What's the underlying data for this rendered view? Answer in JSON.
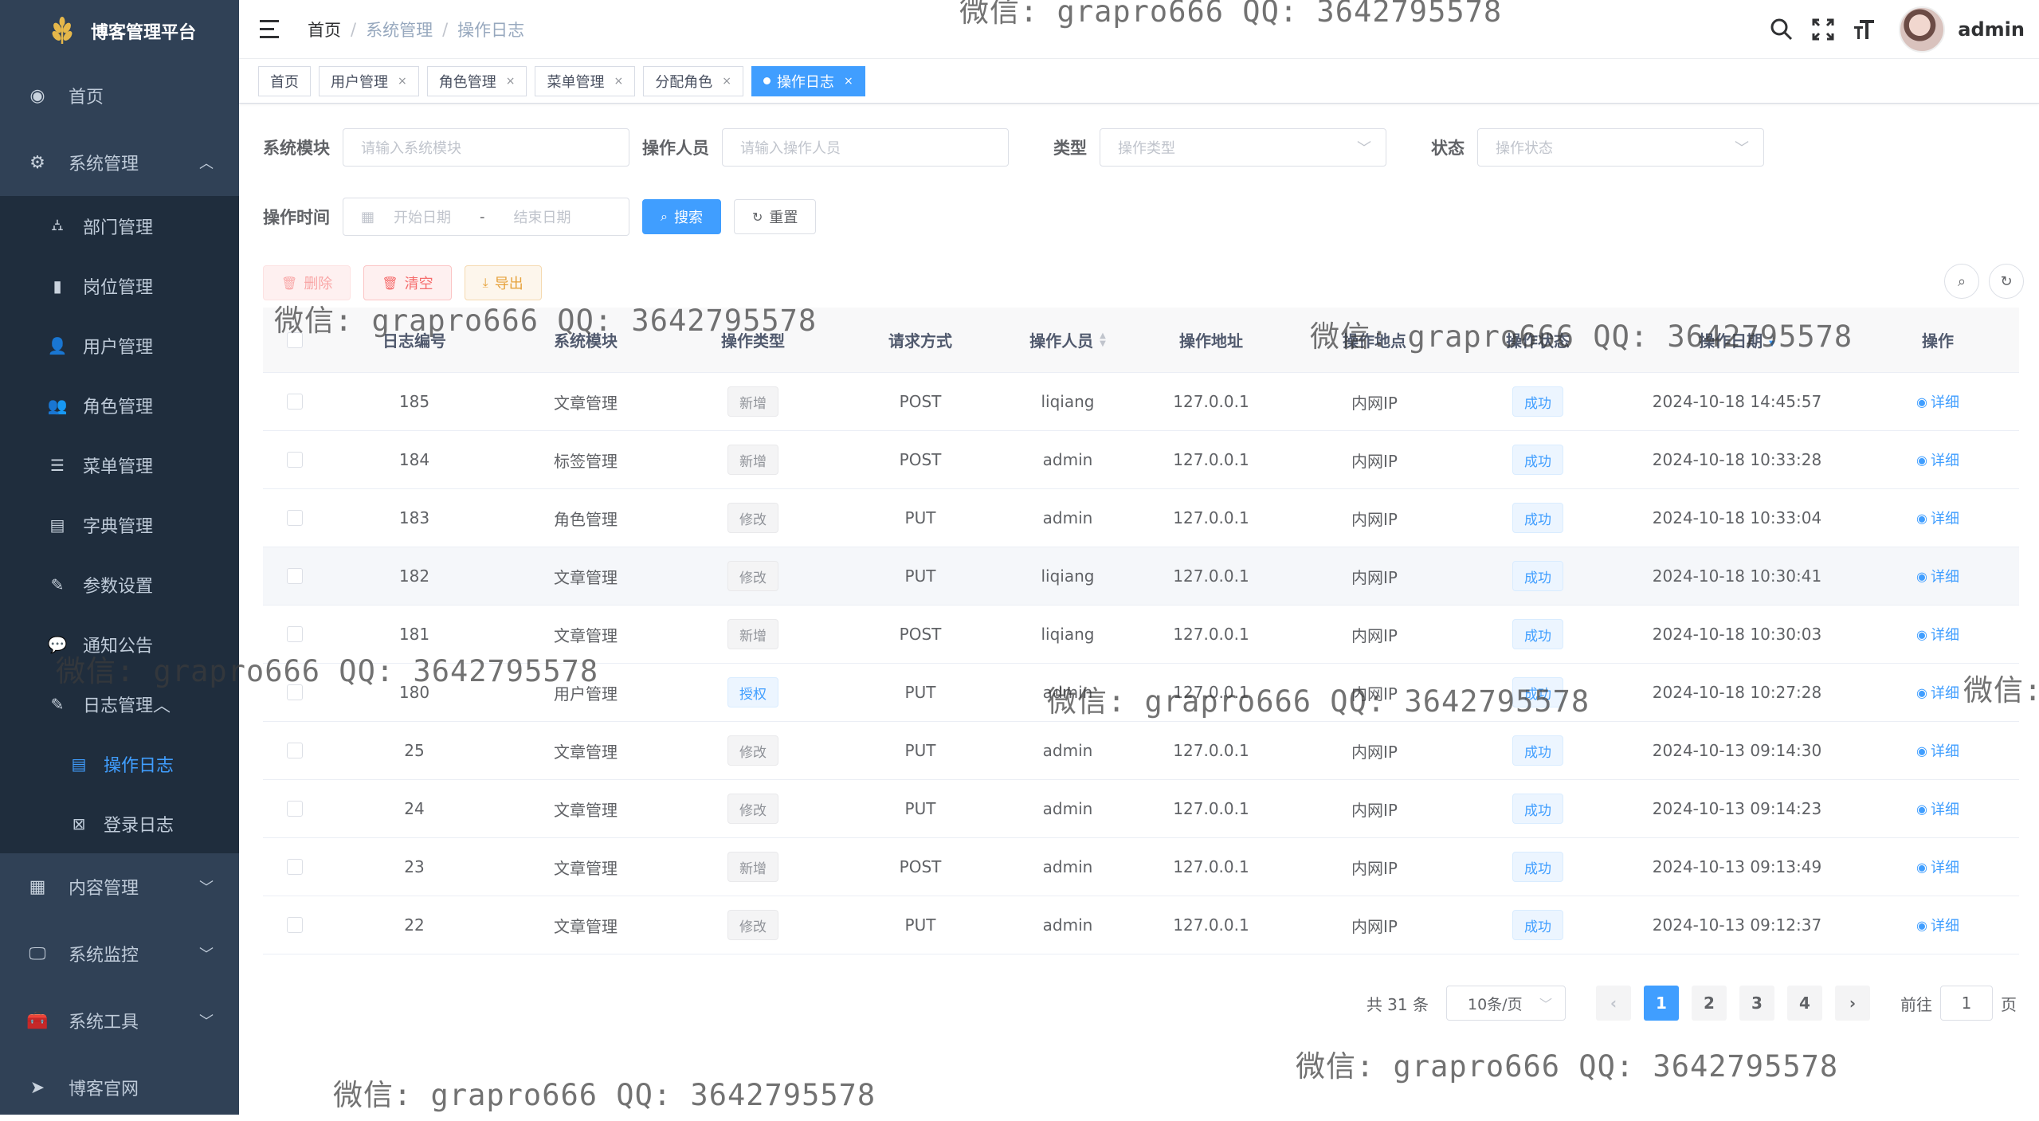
{
  "sidebar": {
    "title": "博客管理平台",
    "menu": {
      "home": "首页",
      "system": "系统管理",
      "dept": "部门管理",
      "post": "岗位管理",
      "user": "用户管理",
      "role": "角色管理",
      "menu": "菜单管理",
      "dict": "字典管理",
      "config": "参数设置",
      "notice": "通知公告",
      "log": "日志管理",
      "oper_log": "操作日志",
      "login_log": "登录日志",
      "content": "内容管理",
      "monitor": "系统监控",
      "tool": "系统工具",
      "site": "博客官网"
    }
  },
  "header": {
    "breadcrumb": [
      "首页",
      "系统管理",
      "操作日志"
    ],
    "username": "admin"
  },
  "tags": [
    "首页",
    "用户管理",
    "角色管理",
    "菜单管理",
    "分配角色",
    "操作日志"
  ],
  "search": {
    "module_label": "系统模块",
    "module_placeholder": "请输入系统模块",
    "operator_label": "操作人员",
    "operator_placeholder": "请输入操作人员",
    "type_label": "类型",
    "type_placeholder": "操作类型",
    "status_label": "状态",
    "status_placeholder": "操作状态",
    "time_label": "操作时间",
    "start_placeholder": "开始日期",
    "range_sep": "-",
    "end_placeholder": "结束日期",
    "search_btn": "搜索",
    "reset_btn": "重置"
  },
  "toolbar": {
    "delete": "删除",
    "clear": "清空",
    "export": "导出"
  },
  "table": {
    "headers": [
      "日志编号",
      "系统模块",
      "操作类型",
      "请求方式",
      "操作人员",
      "操作地址",
      "操作地点",
      "操作状态",
      "操作日期",
      "操作"
    ],
    "rows": [
      {
        "id": "185",
        "module": "文章管理",
        "type": "新增",
        "type_style": "info",
        "method": "POST",
        "operator": "liqiang",
        "ip": "127.0.0.1",
        "location": "内网IP",
        "status": "成功",
        "date": "2024-10-18 14:45:57",
        "action": "详细"
      },
      {
        "id": "184",
        "module": "标签管理",
        "type": "新增",
        "type_style": "info",
        "method": "POST",
        "operator": "admin",
        "ip": "127.0.0.1",
        "location": "内网IP",
        "status": "成功",
        "date": "2024-10-18 10:33:28",
        "action": "详细"
      },
      {
        "id": "183",
        "module": "角色管理",
        "type": "修改",
        "type_style": "info",
        "method": "PUT",
        "operator": "admin",
        "ip": "127.0.0.1",
        "location": "内网IP",
        "status": "成功",
        "date": "2024-10-18 10:33:04",
        "action": "详细"
      },
      {
        "id": "182",
        "module": "文章管理",
        "type": "修改",
        "type_style": "info",
        "method": "PUT",
        "operator": "liqiang",
        "ip": "127.0.0.1",
        "location": "内网IP",
        "status": "成功",
        "date": "2024-10-18 10:30:41",
        "action": "详细"
      },
      {
        "id": "181",
        "module": "文章管理",
        "type": "新增",
        "type_style": "info",
        "method": "POST",
        "operator": "liqiang",
        "ip": "127.0.0.1",
        "location": "内网IP",
        "status": "成功",
        "date": "2024-10-18 10:30:03",
        "action": "详细"
      },
      {
        "id": "180",
        "module": "用户管理",
        "type": "授权",
        "type_style": "primary",
        "method": "PUT",
        "operator": "admin",
        "ip": "127.0.0.1",
        "location": "内网IP",
        "status": "成功",
        "date": "2024-10-18 10:27:28",
        "action": "详细"
      },
      {
        "id": "25",
        "module": "文章管理",
        "type": "修改",
        "type_style": "info",
        "method": "PUT",
        "operator": "admin",
        "ip": "127.0.0.1",
        "location": "内网IP",
        "status": "成功",
        "date": "2024-10-13 09:14:30",
        "action": "详细"
      },
      {
        "id": "24",
        "module": "文章管理",
        "type": "修改",
        "type_style": "info",
        "method": "PUT",
        "operator": "admin",
        "ip": "127.0.0.1",
        "location": "内网IP",
        "status": "成功",
        "date": "2024-10-13 09:14:23",
        "action": "详细"
      },
      {
        "id": "23",
        "module": "文章管理",
        "type": "新增",
        "type_style": "info",
        "method": "POST",
        "operator": "admin",
        "ip": "127.0.0.1",
        "location": "内网IP",
        "status": "成功",
        "date": "2024-10-13 09:13:49",
        "action": "详细"
      },
      {
        "id": "22",
        "module": "文章管理",
        "type": "修改",
        "type_style": "info",
        "method": "PUT",
        "operator": "admin",
        "ip": "127.0.0.1",
        "location": "内网IP",
        "status": "成功",
        "date": "2024-10-13 09:12:37",
        "action": "详细"
      }
    ]
  },
  "pagination": {
    "total": "共 31 条",
    "page_size": "10条/页",
    "pages": [
      "1",
      "2",
      "3",
      "4"
    ],
    "current": "1",
    "goto_label": "前往",
    "goto_value": "1",
    "page_suffix": "页"
  },
  "watermark": "微信: grapro666 QQ: 3642795578",
  "colors": {
    "sidebar_bg": "#304156",
    "submenu_bg": "#1f2d3d",
    "primary": "#409eff",
    "danger": "#f56c6c",
    "warning": "#e6a23c"
  }
}
